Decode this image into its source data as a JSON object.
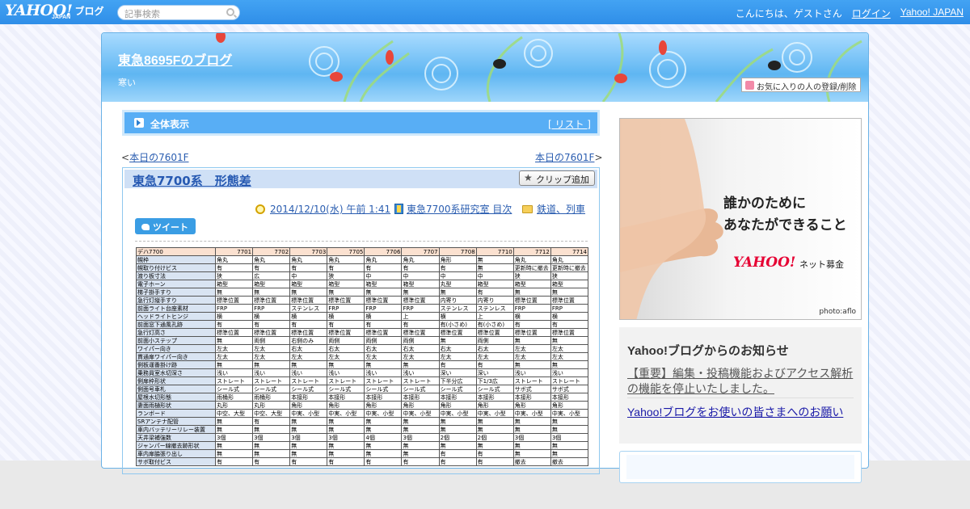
{
  "topbar": {
    "logo_text": "YAHOO!",
    "logo_sub": "JAPAN",
    "logo_blog": "ブログ",
    "search_placeholder": "記事検索",
    "greeting": "こんにちは、ゲストさん",
    "login": "ログイン",
    "yahoo_japan": "Yahoo! JAPAN"
  },
  "blog": {
    "title": "東急8695Fのブログ",
    "description": "寒い",
    "fav_button": "お気に入りの人の登録/削除"
  },
  "section": {
    "label": "全体表示",
    "list_link": "[ リスト ]"
  },
  "pager": {
    "prev": "本日の7601F",
    "next": "本日の7601F"
  },
  "post": {
    "title": "東急7700系　形態差",
    "clip_button": "クリップ追加",
    "date": "2014/12/10(水) 午前 1:41",
    "book": "東急7700系研究室 目次",
    "category": "鉄道、列車",
    "tweet": "ツイート"
  },
  "table": {
    "header": [
      "デハ7700",
      "7701",
      "7702",
      "7703",
      "7705",
      "7706",
      "7707",
      "7708",
      "7710",
      "7712",
      "7714"
    ],
    "rows": [
      [
        "幌枠",
        "角丸",
        "角丸",
        "角丸",
        "角丸",
        "角丸",
        "角丸",
        "角形",
        "無",
        "角丸",
        "角丸"
      ],
      [
        "幌取り付けビス",
        "有",
        "有",
        "有",
        "有",
        "有",
        "有",
        "有",
        "無",
        "更新時に撤去",
        "更新時に撤去"
      ],
      [
        "渡り板寸法",
        "狭",
        "広",
        "中",
        "狭",
        "中",
        "中",
        "中",
        "中",
        "狭",
        "狭"
      ],
      [
        "電子ホーン",
        "箱型",
        "箱型",
        "箱型",
        "箱型",
        "箱型",
        "箱型",
        "丸型",
        "箱型",
        "箱型",
        "箱型"
      ],
      [
        "梯子掛手すり",
        "無",
        "無",
        "無",
        "無",
        "無",
        "無",
        "無",
        "有",
        "無",
        "無"
      ],
      [
        "急行灯縦手すり",
        "標準位置",
        "標準位置",
        "標準位置",
        "標準位置",
        "標準位置",
        "標準位置",
        "内寄り",
        "内寄り",
        "標準位置",
        "標準位置"
      ],
      [
        "前面ライト台座素材",
        "FRP",
        "FRP",
        "ステンレス",
        "FRP",
        "FRP",
        "FRP",
        "ステンレス",
        "ステンレス",
        "FRP",
        "FRP"
      ],
      [
        "ヘッドライトヒンジ",
        "横",
        "横",
        "横",
        "横",
        "横",
        "上",
        "横",
        "上",
        "横",
        "横"
      ],
      [
        "前面窓下通風孔跡",
        "有",
        "有",
        "有",
        "有",
        "有",
        "有",
        "有(小さめ)",
        "有(小さめ)",
        "有",
        "有"
      ],
      [
        "急行灯高さ",
        "標準位置",
        "標準位置",
        "標準位置",
        "標準位置",
        "標準位置",
        "標準位置",
        "標準位置",
        "標準位置",
        "標準位置",
        "標準位置"
      ],
      [
        "前面小ステップ",
        "無",
        "両側",
        "右側のみ",
        "両側",
        "両側",
        "両側",
        "無",
        "両側",
        "無",
        "無"
      ],
      [
        "ワイパー向き",
        "左太",
        "左太",
        "右太",
        "右太",
        "右太",
        "右太",
        "右太",
        "右太",
        "左太",
        "左太"
      ],
      [
        "貫通扉ワイパー向き",
        "左太",
        "左太",
        "左太",
        "左太",
        "左太",
        "左太",
        "左太",
        "左太",
        "左太",
        "左太"
      ],
      [
        "側板運番掛け跡",
        "無",
        "無",
        "無",
        "無",
        "無",
        "無",
        "有",
        "有",
        "無",
        "無"
      ],
      [
        "乗務員室水切深さ",
        "浅い",
        "浅い",
        "浅い",
        "浅い",
        "浅い",
        "浅い",
        "深い",
        "深い",
        "浅い",
        "浅い"
      ],
      [
        "側扉枠形状",
        "ストレート",
        "ストレート",
        "ストレート",
        "ストレート",
        "ストレート",
        "ストレート",
        "下半分広",
        "下1/3広",
        "ストレート",
        "ストレート"
      ],
      [
        "側面号車札",
        "シール式",
        "シール式",
        "シール式",
        "シール式",
        "シール式",
        "シール式",
        "シール式",
        "シール式",
        "サボ式",
        "サボ式"
      ],
      [
        "屋根水切形態",
        "雨桶形",
        "雨桶形",
        "本接形",
        "本接形",
        "本接形",
        "本接形",
        "本接形",
        "本接形",
        "本接形",
        "本接形"
      ],
      [
        "妻面雨樋形状",
        "丸形",
        "丸形",
        "角形",
        "角形",
        "角形",
        "角形",
        "角形",
        "角形",
        "角形",
        "角形"
      ],
      [
        "ランボード",
        "中空、大型",
        "中空、大型",
        "中実、小型",
        "中実、小型",
        "中実、小型",
        "中実、小型",
        "中実、小型",
        "中実、小型",
        "中実、小型",
        "中実、小型"
      ],
      [
        "SRアンテナ配管",
        "無",
        "有",
        "無",
        "無",
        "無",
        "無",
        "無",
        "無",
        "無",
        "無"
      ],
      [
        "車内バッテリーリレー装置",
        "無",
        "無",
        "無",
        "無",
        "無",
        "無",
        "無",
        "無",
        "無",
        "無"
      ],
      [
        "天井梁補強数",
        "3個",
        "3個",
        "3個",
        "3個",
        "4個",
        "3個",
        "2個",
        "2個",
        "3個",
        "3個"
      ],
      [
        "ジャンパー線撤去跡形状",
        "無",
        "無",
        "無",
        "無",
        "無",
        "無",
        "無",
        "無",
        "無",
        "無"
      ],
      [
        "車内扉脇張り出し",
        "無",
        "無",
        "無",
        "無",
        "無",
        "無",
        "有",
        "有",
        "無",
        "無"
      ],
      [
        "サボ取付ビス",
        "有",
        "有",
        "有",
        "有",
        "有",
        "有",
        "有",
        "有",
        "撤去",
        "撤去"
      ]
    ]
  },
  "ad": {
    "line1": "誰かのために",
    "line2": "あなたができること",
    "logo": "YAHOO!",
    "logo_sub": "ネット募金",
    "credit": "photo:aflo"
  },
  "notice": {
    "heading": "Yahoo!ブログからのお知らせ",
    "item1": "【重要】編集・投稿機能およびアクセス解析の機能を停止いたしました。",
    "item2": "Yahoo!ブログをお使いの皆さまへのお願い"
  },
  "colors": {
    "topbar": "#2f8ee8",
    "section_head": "#58aef5",
    "link": "#2a5db0"
  }
}
